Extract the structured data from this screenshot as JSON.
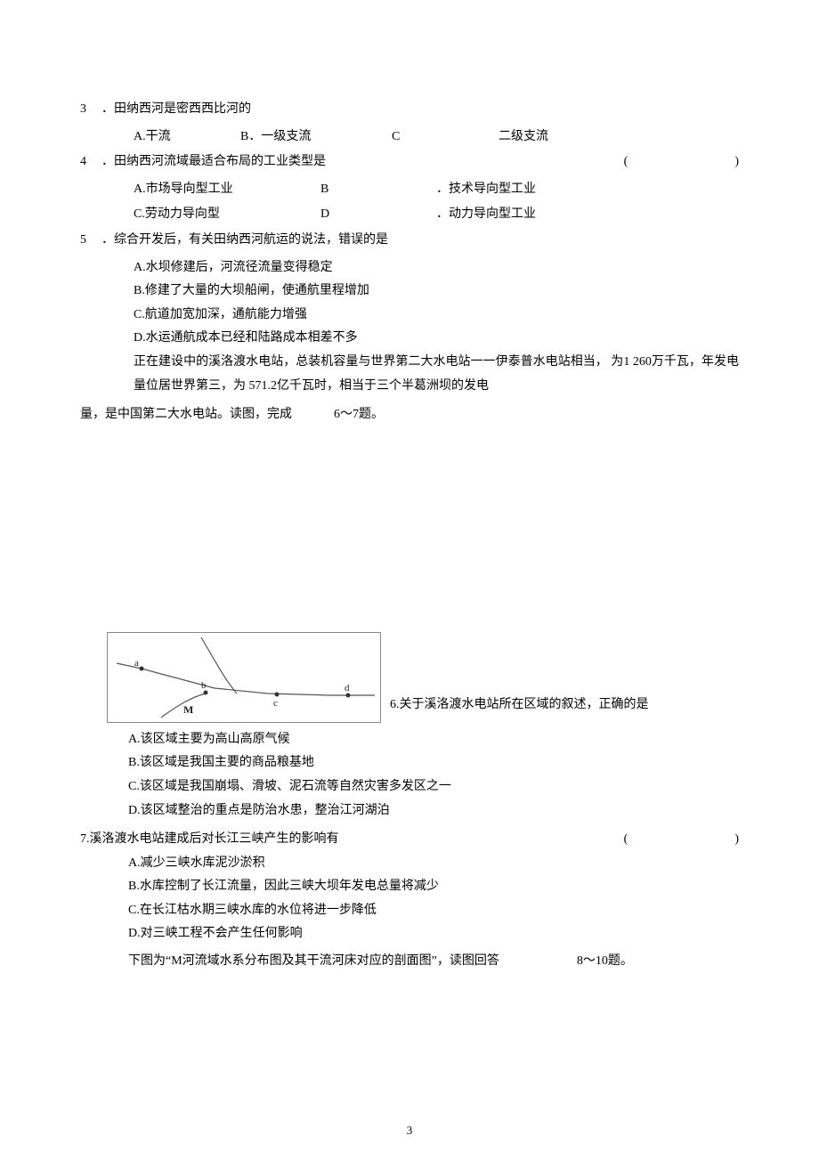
{
  "q3": {
    "num": "3",
    "stem": "．田纳西河是密西西比河的",
    "opts": {
      "a": "A.干流",
      "b": "B．一级支流",
      "c_letter": "C",
      "c_text": "二级支流"
    }
  },
  "q4": {
    "num": "4",
    "stem": "．田纳西河流域最适合布局的工业类型是",
    "paren_l": "(",
    "paren_r": ")",
    "opts": {
      "a": "A.市场导向型工业",
      "b_letter": "B",
      "b_text": "．技术导向型工业",
      "c": "C.劳动力导向型",
      "d_letter": "D",
      "d_text": "．动力导向型工业"
    }
  },
  "q5": {
    "num": "5",
    "stem": "．综合开发后，有关田纳西河航运的说法，错误的是",
    "opts": {
      "a": "A.水坝修建后，河流径流量变得稳定",
      "b": "B.修建了大量的大坝船闸，使通航里程增加",
      "c": "C.航道加宽加深，通航能力增强",
      "d": "D.水运通航成本已经和陆路成本相差不多"
    }
  },
  "passage1": {
    "line1": "正在建设中的溪洛渡水电站，总装机容量与世界第二大水电站一一伊泰普水电站相当， 为1 260万千瓦，年发电量位居世界第三，为 571.2亿千瓦时，相当于三个半葛洲坝的发电",
    "line2_pre": "量，是中国第二大水电站。读图，完成",
    "line2_post": "6〜7题。"
  },
  "q6": {
    "caption": "6.关于溪洛渡水电站所在区域的叙述，正确的是",
    "opts": {
      "a": "A.该区域主要为高山高原气候",
      "b": "B.该区域是我国主要的商品粮基地",
      "c": "C.该区域是我国崩塌、滑坡、泥石流等自然灾害多发区之一",
      "d": "D.该区域整治的重点是防治水患，整治江河湖泊"
    }
  },
  "q7": {
    "stem": "7.溪洛渡水电站建成后对长江三峡产生的影响有",
    "paren_l": "(",
    "paren_r": ")",
    "opts": {
      "a": "A.减少三峡水库泥沙淤积",
      "b": "B.水库控制了长江流量，因此三峡大坝年发电总量将减少",
      "c": "C.在长江枯水期三峡水库的水位将进一步降低",
      "d": "D.对三峡工程不会产生任何影响"
    }
  },
  "passage2": {
    "pre": "下图为“M河流域水系分布图及其干流河床对应的剖面图”，读图回答",
    "post": "8〜10题。"
  },
  "fig_labels": {
    "a": "a",
    "b": "b",
    "c": "c",
    "d": "d",
    "M": "M"
  },
  "page_number": "3"
}
